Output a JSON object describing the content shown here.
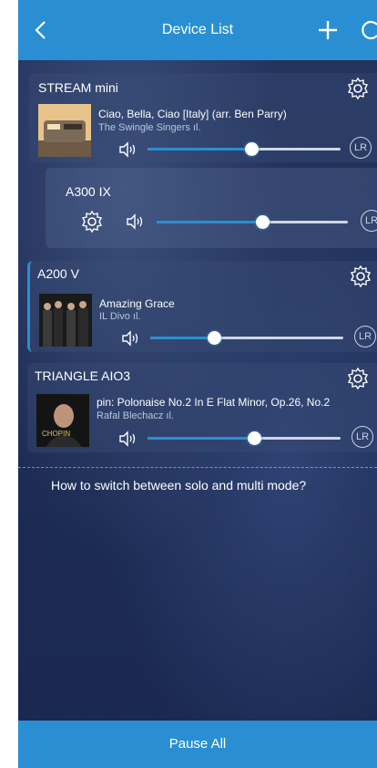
{
  "header": {
    "title": "Device List",
    "icons": [
      "chevron-left-icon",
      "plus-icon",
      "refresh-icon"
    ]
  },
  "devices": [
    {
      "name": "STREAM mini",
      "track": "Ciao, Bella, Ciao [Italy] (arr. Ben Parry)",
      "artist": "The Swingle Singers ıl.",
      "volume_fraction": 0.54,
      "channel": "LR"
    },
    {
      "name": "A300 IX",
      "volume_fraction": 0.55,
      "channel": "LR"
    },
    {
      "name": "A200 V",
      "track": "Amazing Grace",
      "artist": "IL Divo ıl.",
      "volume_fraction": 0.33,
      "channel": "LR",
      "active": true
    },
    {
      "name": "TRIANGLE AIO3",
      "track": "pin: Polonaise No.2 In E Flat Minor, Op.26, No.2",
      "artist": "Rafal Blechacz ıl.",
      "volume_fraction": 0.55,
      "channel": "LR"
    }
  ],
  "help_text": "How to switch between solo and multi mode?",
  "footer": {
    "pause_label": "Pause All"
  },
  "colors": {
    "accent": "#2a8fd2",
    "background": "#1e2d55"
  }
}
